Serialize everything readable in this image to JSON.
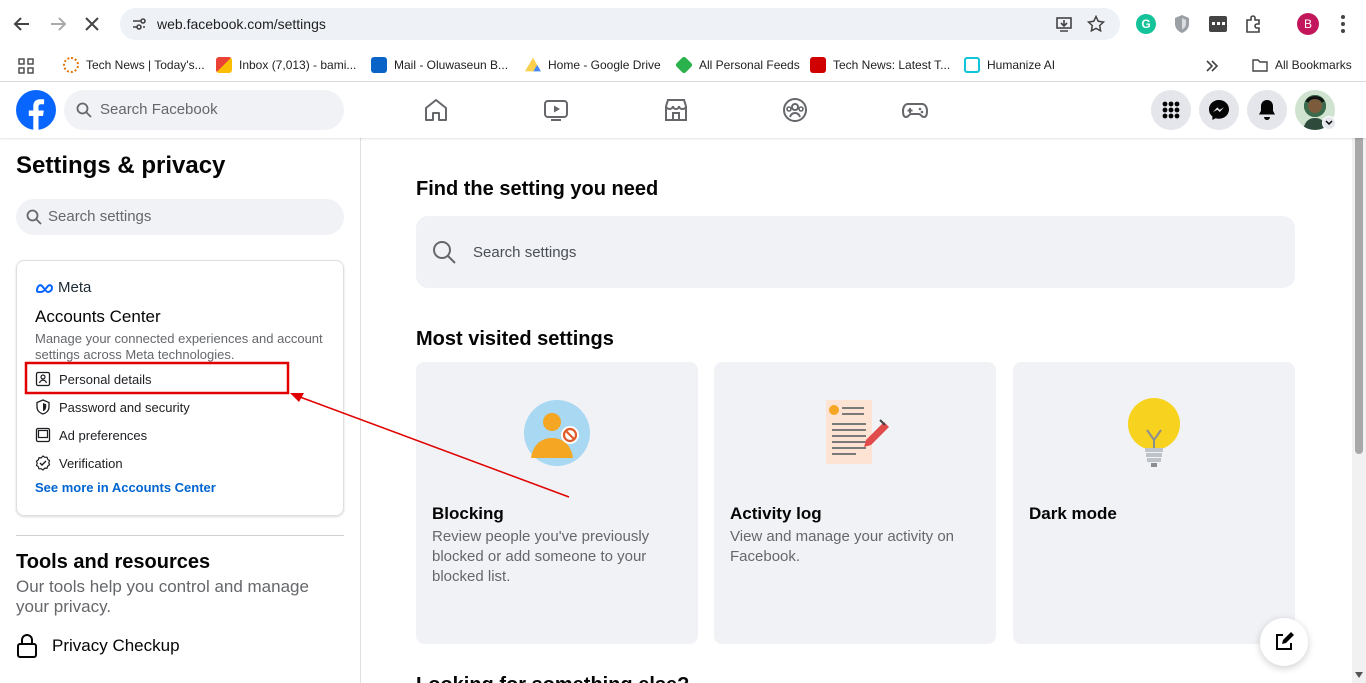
{
  "browser": {
    "url": "web.facebook.com/settings",
    "profile_initial": "B",
    "bookmarks": [
      {
        "label": "Tech News | Today's...",
        "color": "#e37400"
      },
      {
        "label": "Inbox (7,013) - bami...",
        "color": "#ea4335"
      },
      {
        "label": "Mail - Oluwaseun B...",
        "color": "#0a64c8"
      },
      {
        "label": "Home - Google Drive",
        "color": "#1fa463"
      },
      {
        "label": "All Personal Feeds",
        "color": "#2bb24c"
      },
      {
        "label": "Tech News: Latest T...",
        "color": "#d00000"
      },
      {
        "label": "Humanize AI",
        "color": "#11c5d9"
      }
    ],
    "all_bookmarks_label": "All Bookmarks"
  },
  "fb": {
    "search_placeholder": "Search Facebook",
    "brand_color": "#0866ff"
  },
  "left": {
    "title": "Settings & privacy",
    "search_placeholder": "Search settings",
    "meta_label": "Meta",
    "accounts_center": {
      "title": "Accounts Center",
      "description": "Manage your connected experiences and account settings across Meta technologies.",
      "items": [
        {
          "label": "Personal details",
          "icon": "id-card-icon"
        },
        {
          "label": "Password and security",
          "icon": "shield-icon"
        },
        {
          "label": "Ad preferences",
          "icon": "monitor-icon"
        },
        {
          "label": "Verification",
          "icon": "badge-check-icon"
        }
      ],
      "see_more": "See more in Accounts Center"
    },
    "tools": {
      "title": "Tools and resources",
      "description": "Our tools help you control and manage your privacy.",
      "privacy_checkup": "Privacy Checkup"
    }
  },
  "main": {
    "find_title": "Find the setting you need",
    "search_placeholder": "Search settings",
    "most_visited_title": "Most visited settings",
    "cards": [
      {
        "title": "Blocking",
        "description": "Review people you've previously blocked or add someone to your blocked list."
      },
      {
        "title": "Activity log",
        "description": "View and manage your activity on Facebook."
      },
      {
        "title": "Dark mode",
        "description": ""
      }
    ],
    "next_section_partial": "Looking for something else?"
  },
  "annotation": {
    "highlight_color": "#e00000"
  }
}
